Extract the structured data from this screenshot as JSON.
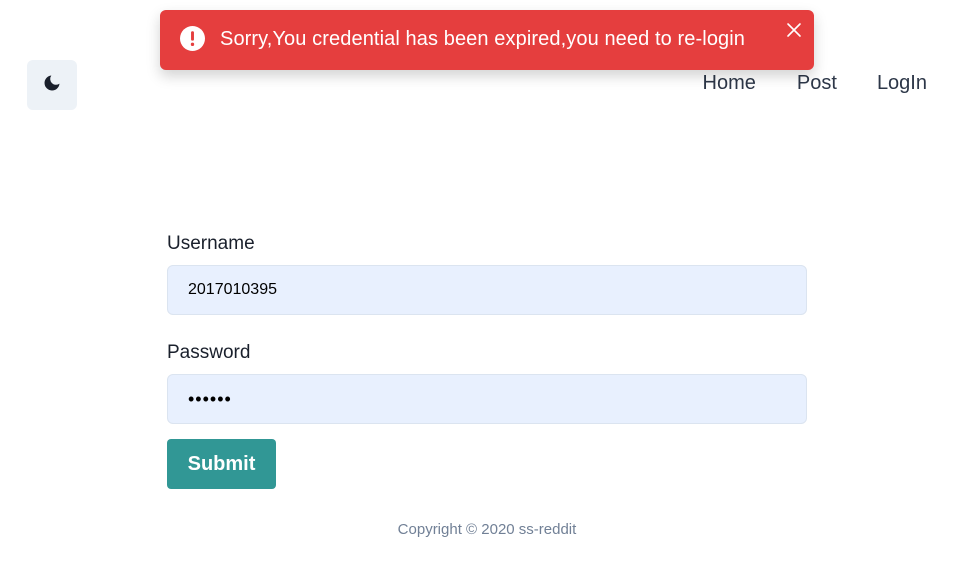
{
  "theme_toggle": {
    "icon": "moon-icon"
  },
  "nav": {
    "items": [
      {
        "label": "Home"
      },
      {
        "label": "Post"
      },
      {
        "label": "LogIn"
      }
    ]
  },
  "toast": {
    "message": "Sorry,You credential has been expired,you need to re-login",
    "icon": "warning-icon",
    "close_icon": "close-icon",
    "color": "#e53e3e"
  },
  "form": {
    "username": {
      "label": "Username",
      "value": "2017010395"
    },
    "password": {
      "label": "Password",
      "value": "••••••"
    },
    "submit_label": "Submit",
    "submit_color": "#319795"
  },
  "footer": {
    "text": "Copyright © 2020 ss-reddit"
  }
}
